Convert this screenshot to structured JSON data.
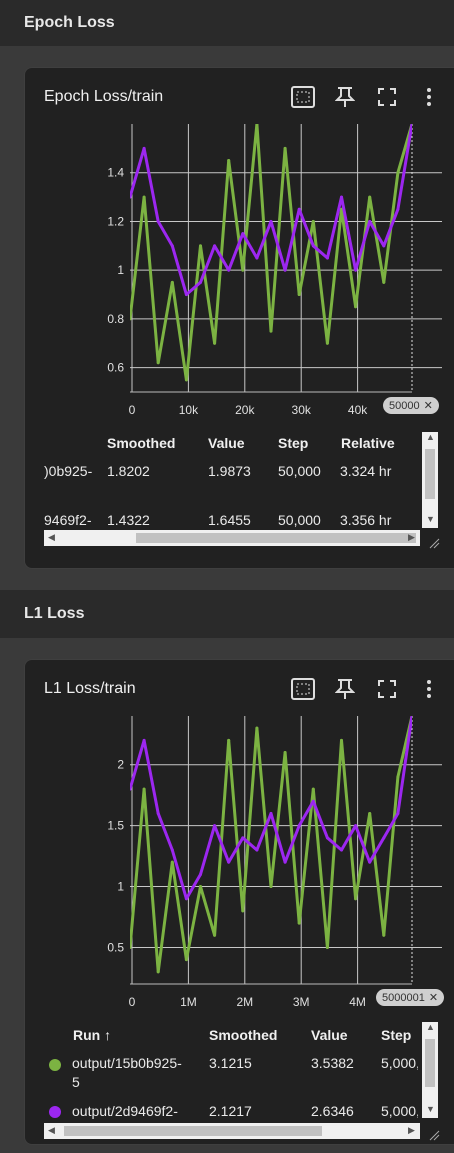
{
  "sections": {
    "epoch": "Epoch Loss",
    "l1": "L1 Loss"
  },
  "cards": {
    "epoch": {
      "title": "Epoch Loss/train",
      "y_ticks": [
        "1.4",
        "1.2",
        "1",
        "0.8",
        "0.6"
      ],
      "x_ticks": [
        "0",
        "10k",
        "20k",
        "30k",
        "40k"
      ],
      "step_chip": "50000",
      "columns": [
        "Smoothed",
        "Value",
        "Step",
        "Relative"
      ],
      "rows": [
        {
          "run": ")0b925-",
          "smoothed": "1.8202",
          "value": "1.9873",
          "step": "50,000",
          "relative": "3.324 hr"
        },
        {
          "run": "9469f2-",
          "smoothed": "1.4322",
          "value": "1.6455",
          "step": "50,000",
          "relative": "3.356 hr"
        }
      ]
    },
    "l1": {
      "title": "L1 Loss/train",
      "y_ticks": [
        "2",
        "1.5",
        "1",
        "0.5"
      ],
      "x_ticks": [
        "0",
        "1M",
        "2M",
        "3M",
        "4M"
      ],
      "step_chip": "5000001",
      "columns": [
        "Run ↑",
        "Smoothed",
        "Value",
        "Step"
      ],
      "rows": [
        {
          "run": "output/15b0b925-",
          "run_line2": "5",
          "smoothed": "3.1215",
          "value": "3.5382",
          "step": "5,000,",
          "color": "#7cb342"
        },
        {
          "run": "output/2d9469f2-",
          "run_line2": "",
          "smoothed": "2.1217",
          "value": "2.6346",
          "step": "5,000,",
          "color": "#9c27f0"
        }
      ]
    }
  },
  "colors": {
    "green": "#7cb342",
    "purple": "#9c27f0",
    "card_bg": "#212121",
    "page_bg": "#3a3a3a"
  },
  "chart_data": [
    {
      "type": "line",
      "title": "Epoch Loss/train",
      "xlabel": "",
      "ylabel": "",
      "xlim": [
        0,
        50000
      ],
      "ylim": [
        0.5,
        1.6
      ],
      "series": [
        {
          "name": "output/15b0b925-5",
          "color": "#7cb342",
          "x": [
            0,
            2500,
            5000,
            7500,
            10000,
            12500,
            15000,
            17500,
            20000,
            22500,
            25000,
            27500,
            30000,
            32500,
            35000,
            37500,
            40000,
            42500,
            45000,
            47500,
            50000
          ],
          "values": [
            0.8,
            1.3,
            0.62,
            0.95,
            0.55,
            1.1,
            0.7,
            1.45,
            1.0,
            1.6,
            0.75,
            1.5,
            0.9,
            1.2,
            0.7,
            1.25,
            0.85,
            1.3,
            0.95,
            1.4,
            1.99
          ]
        },
        {
          "name": "output/2d9469f2-",
          "color": "#9c27f0",
          "x": [
            0,
            2500,
            5000,
            7500,
            10000,
            12500,
            15000,
            17500,
            20000,
            22500,
            25000,
            27500,
            30000,
            32500,
            35000,
            37500,
            40000,
            42500,
            45000,
            47500,
            50000
          ],
          "values": [
            1.3,
            1.5,
            1.2,
            1.1,
            0.9,
            0.95,
            1.1,
            1.0,
            1.15,
            1.05,
            1.2,
            1.0,
            1.25,
            1.1,
            1.05,
            1.3,
            1.0,
            1.2,
            1.1,
            1.25,
            1.65
          ]
        }
      ]
    },
    {
      "type": "line",
      "title": "L1 Loss/train",
      "xlabel": "",
      "ylabel": "",
      "xlim": [
        0,
        5000000
      ],
      "ylim": [
        0.2,
        2.4
      ],
      "series": [
        {
          "name": "output/15b0b925-5",
          "color": "#7cb342",
          "x": [
            0,
            250000,
            500000,
            750000,
            1000000,
            1250000,
            1500000,
            1750000,
            2000000,
            2250000,
            2500000,
            2750000,
            3000000,
            3250000,
            3500000,
            3750000,
            4000000,
            4250000,
            4500000,
            4750000,
            5000000
          ],
          "values": [
            0.5,
            1.8,
            0.3,
            1.2,
            0.4,
            1.0,
            0.6,
            2.2,
            0.8,
            2.3,
            1.0,
            2.1,
            0.7,
            1.8,
            0.5,
            2.2,
            0.9,
            1.6,
            0.6,
            1.9,
            3.54
          ]
        },
        {
          "name": "output/2d9469f2-",
          "color": "#9c27f0",
          "x": [
            0,
            250000,
            500000,
            750000,
            1000000,
            1250000,
            1500000,
            1750000,
            2000000,
            2250000,
            2500000,
            2750000,
            3000000,
            3250000,
            3500000,
            3750000,
            4000000,
            4250000,
            4500000,
            4750000,
            5000000
          ],
          "values": [
            1.8,
            2.2,
            1.6,
            1.3,
            0.9,
            1.1,
            1.5,
            1.2,
            1.4,
            1.3,
            1.6,
            1.2,
            1.5,
            1.7,
            1.4,
            1.3,
            1.5,
            1.2,
            1.4,
            1.6,
            2.63
          ]
        }
      ]
    }
  ]
}
